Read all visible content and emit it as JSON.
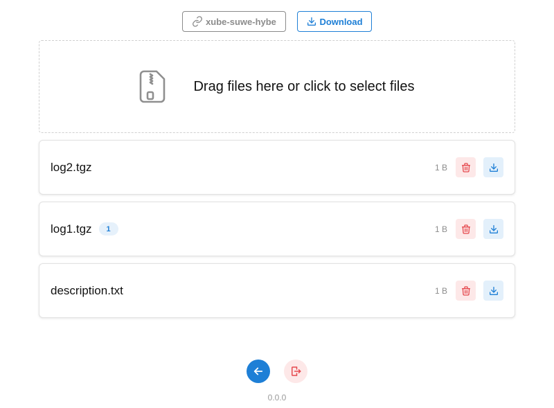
{
  "toolbar": {
    "share_label": "xube-suwe-hybe",
    "share_icon": "link-icon",
    "download_all_label": "Download",
    "download_all_icon": "download-icon"
  },
  "dropzone": {
    "text": "Drag files here or click to select files",
    "icon": "file-zip-icon"
  },
  "files": [
    {
      "name": "log2.tgz",
      "badge": "",
      "size": "1 B"
    },
    {
      "name": "log1.tgz",
      "badge": "1",
      "size": "1 B"
    },
    {
      "name": "description.txt",
      "badge": "",
      "size": "1 B"
    }
  ],
  "footer": {
    "back_icon": "arrow-left-icon",
    "logout_icon": "logout-icon",
    "version": "0.0.0"
  },
  "colors": {
    "accent": "#1e7fd6",
    "danger": "#e5484d",
    "danger_bg": "#fde8e8",
    "accent_bg": "#e3f0fb",
    "muted": "#8c8c8c"
  }
}
